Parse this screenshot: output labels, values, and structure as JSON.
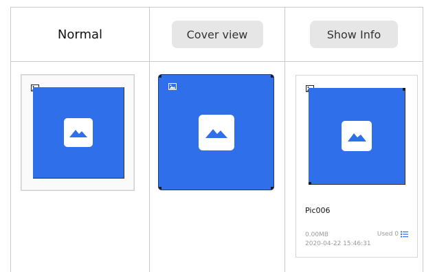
{
  "columns": {
    "normal": {
      "label": "Normal"
    },
    "cover_view": {
      "button_label": "Cover view"
    },
    "show_info": {
      "button_label": "Show Info"
    }
  },
  "info_card": {
    "file_name": "Pic006",
    "file_size": "0.00MB",
    "used_label": "Used 0",
    "date": "2020-04-22 15:46:31"
  },
  "icons": {
    "thumbnail_placeholder": "image-placeholder-icon",
    "corner_badge": "image-badge-icon",
    "usage_list": "list-icon"
  },
  "colors": {
    "thumbnail_blue": "#2f6fea",
    "usage_icon_blue": "#2f6fea",
    "button_gray": "#e6e6e6",
    "grid_line": "#c9c9c9"
  }
}
